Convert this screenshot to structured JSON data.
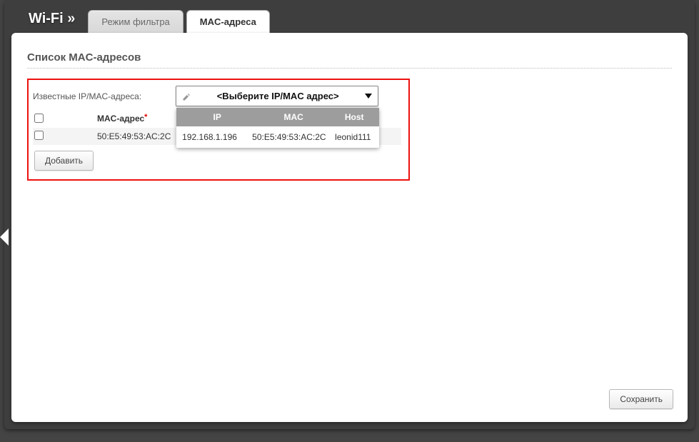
{
  "header": {
    "title": "Wi-Fi »",
    "tabs": [
      {
        "label": "Режим фильтра"
      },
      {
        "label": "MAC-адреса"
      }
    ]
  },
  "section": {
    "title": "Список MAC-адресов",
    "known_label": "Известные IP/MAC-адреса:"
  },
  "dropdown": {
    "placeholder": "<Выберите IP/MAC адрес>",
    "columns": {
      "ip": "IP",
      "mac": "MAC",
      "host": "Host"
    },
    "options": [
      {
        "ip": "192.168.1.196",
        "mac": "50:E5:49:53:AC:2C",
        "host": "leonid111"
      }
    ]
  },
  "table": {
    "mac_header": "MAC-адрес",
    "rows": [
      {
        "mac": "50:E5:49:53:AC:2C"
      }
    ]
  },
  "buttons": {
    "add": "Добавить",
    "save": "Сохранить"
  }
}
